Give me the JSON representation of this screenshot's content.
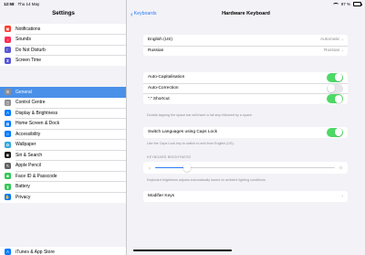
{
  "status_bar": {
    "time": "12:58",
    "date": "Thu 14 May",
    "battery": "97 %",
    "battery_level": 0.97,
    "icons": [
      "wifi-icon",
      "battery-icon"
    ]
  },
  "sidebar": {
    "title": "Settings",
    "groups": [
      {
        "items": [
          {
            "label": "Notifications",
            "icon": "notifications-icon",
            "color": "#ff3b30",
            "glyph": "▣"
          },
          {
            "label": "Sounds",
            "icon": "sounds-icon",
            "color": "#ff2d55",
            "glyph": "♪"
          },
          {
            "label": "Do Not Disturb",
            "icon": "moon-icon",
            "color": "#5856d6",
            "glyph": "☾"
          },
          {
            "label": "Screen Time",
            "icon": "hourglass-icon",
            "color": "#5856d6",
            "glyph": "⧗"
          }
        ]
      },
      {
        "items": [
          {
            "label": "General",
            "icon": "gear-icon",
            "color": "#8e8e93",
            "glyph": "⚙",
            "selected": true
          },
          {
            "label": "Control Centre",
            "icon": "control-centre-icon",
            "color": "#8e8e93",
            "glyph": "◫"
          },
          {
            "label": "Display & Brightness",
            "icon": "display-icon",
            "color": "#007aff",
            "glyph": "A"
          },
          {
            "label": "Home Screen & Dock",
            "icon": "home-screen-icon",
            "color": "#007aff",
            "glyph": "▦"
          },
          {
            "label": "Accessibility",
            "icon": "accessibility-icon",
            "color": "#007aff",
            "glyph": "☺"
          },
          {
            "label": "Wallpaper",
            "icon": "wallpaper-icon",
            "color": "#34aadc",
            "glyph": "✿"
          },
          {
            "label": "Siri & Search",
            "icon": "siri-icon",
            "color": "#1c1c1e",
            "glyph": "◉"
          },
          {
            "label": "Apple Pencil",
            "icon": "pencil-icon",
            "color": "#636366",
            "glyph": "✎"
          },
          {
            "label": "Face ID & Passcode",
            "icon": "face-id-icon",
            "color": "#34c759",
            "glyph": "☻"
          },
          {
            "label": "Battery",
            "icon": "battery-setting-icon",
            "color": "#34c759",
            "glyph": "▮"
          },
          {
            "label": "Privacy",
            "icon": "privacy-hand-icon",
            "color": "#007aff",
            "glyph": "✋"
          }
        ]
      },
      {
        "items": [
          {
            "label": "iTunes & App Store",
            "icon": "app-store-icon",
            "color": "#007aff",
            "glyph": "A"
          }
        ]
      }
    ]
  },
  "detail": {
    "back_label": "Keyboards",
    "title": "Hardware Keyboard",
    "languages": [
      {
        "label": "English (US)",
        "value": "Automatic"
      },
      {
        "label": "Russian",
        "value": "Russian"
      }
    ],
    "options": [
      {
        "label": "Auto-Capitalisation",
        "on": true
      },
      {
        "label": "Auto-Correction",
        "on": false
      },
      {
        "label": "“.” Shortcut",
        "on": true
      }
    ],
    "options_footer": "Double-tapping the space bar will insert a full stop followed by a space.",
    "caps_lock": {
      "label": "Switch Languages using Caps Lock",
      "on": true
    },
    "caps_lock_footer": "Use the Caps Lock key to switch to and from English (US).",
    "brightness_header": "KEYBOARD BRIGHTNESS",
    "brightness_level": 0.18,
    "brightness_footer": "Keyboard brightness adjusts automatically based on ambient lighting conditions.",
    "modifier_keys": "Modifier Keys",
    "accent_color": "#2c7cf6",
    "toggle_on_color": "#4cd964"
  }
}
